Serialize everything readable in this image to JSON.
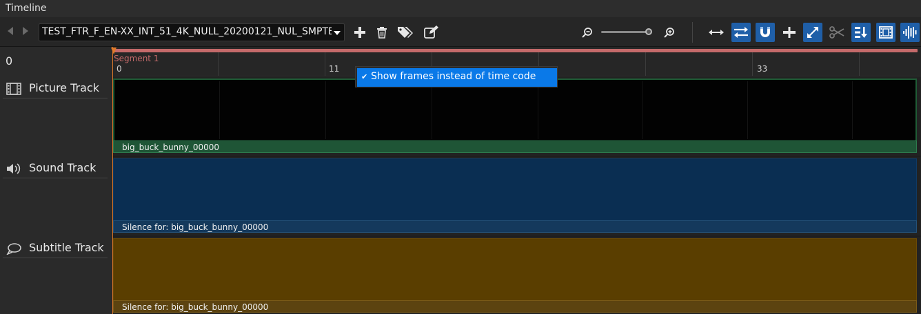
{
  "window": {
    "title": "Timeline"
  },
  "toolbar": {
    "composition_name": "TEST_FTR_F_EN-XX_INT_51_4K_NULL_20200121_NUL_SMPTE",
    "zoom_level": 0.9,
    "icons": [
      "chevron-left-icon",
      "chevron-right-icon",
      "plus-icon",
      "trash-icon",
      "tags-icon",
      "edit-icon",
      "zoom-out-icon",
      "zoom-in-icon",
      "arrows-horizontal-icon",
      "swap-icon",
      "magnet-icon",
      "split-line-icon",
      "expand-icon",
      "scissors-icon",
      "sort-down-icon",
      "film-strip-icon",
      "waveform-icon"
    ]
  },
  "ruler": {
    "cursor_value": "0",
    "segment_label": "Segment 1",
    "tick_labels": [
      "0",
      "11",
      "33"
    ]
  },
  "context_menu": {
    "items": [
      {
        "label": "Show frames instead of time code",
        "checked": true,
        "check_glyph": "✔"
      }
    ]
  },
  "tracks": [
    {
      "name": "Picture Track",
      "icon": "film-icon",
      "clip_label": "big_buck_bunny_00000",
      "color": "#1f5536"
    },
    {
      "name": "Sound Track",
      "icon": "speaker-icon",
      "clip_label": "Silence for: big_buck_bunny_00000",
      "color": "#0a2e52"
    },
    {
      "name": "Subtitle Track",
      "icon": "speech-bubble-icon",
      "clip_label": "Silence for: big_buck_bunny_00000",
      "color": "#5a3e00"
    }
  ],
  "colors": {
    "accent": "#1f5fa8",
    "playhead": "#e07a2a",
    "segment": "#c46a6a",
    "menu_highlight": "#0a79e8"
  }
}
